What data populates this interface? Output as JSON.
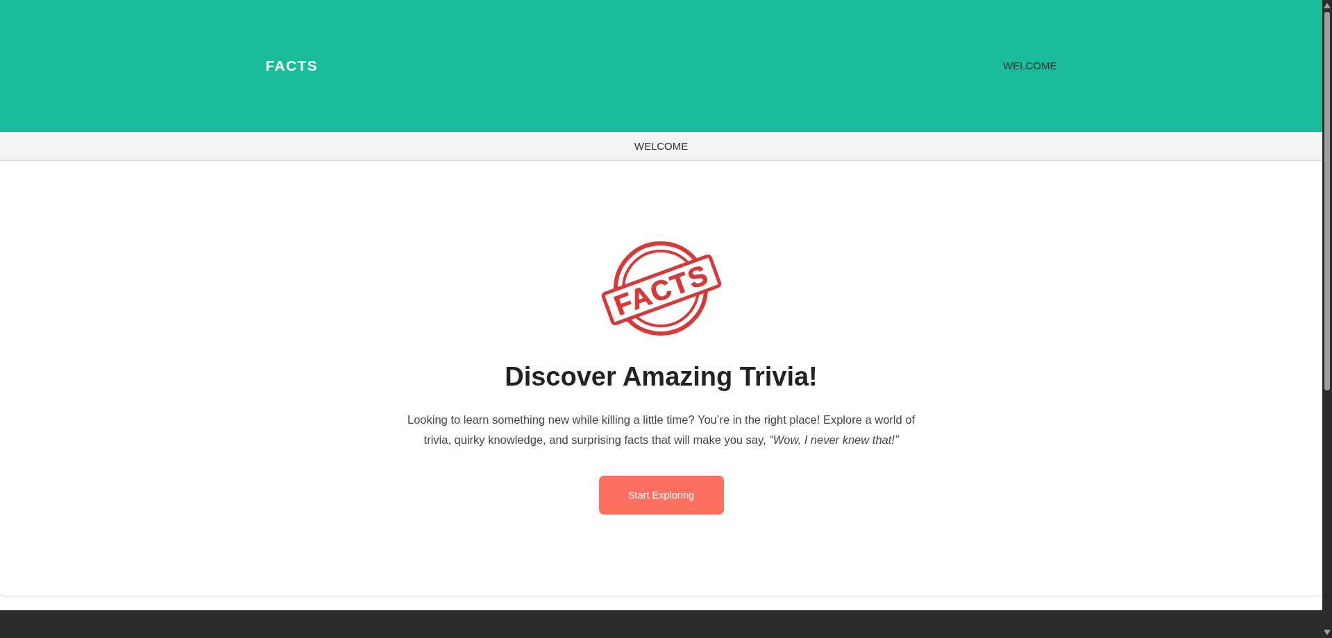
{
  "header": {
    "logo": "FACTS",
    "nav": [
      {
        "label": "WELCOME"
      }
    ]
  },
  "subnav": {
    "items": [
      {
        "label": "WELCOME"
      }
    ]
  },
  "hero": {
    "stamp_text": "FACTS",
    "title": "Discover Amazing Trivia!",
    "text": "Looking to learn something new while killing a little time? You’re in the right place! Explore a world of trivia, quirky knowledge, and surprising facts that will make you say, *“Wow, I never knew that!”*",
    "button": "Start Exploring"
  }
}
